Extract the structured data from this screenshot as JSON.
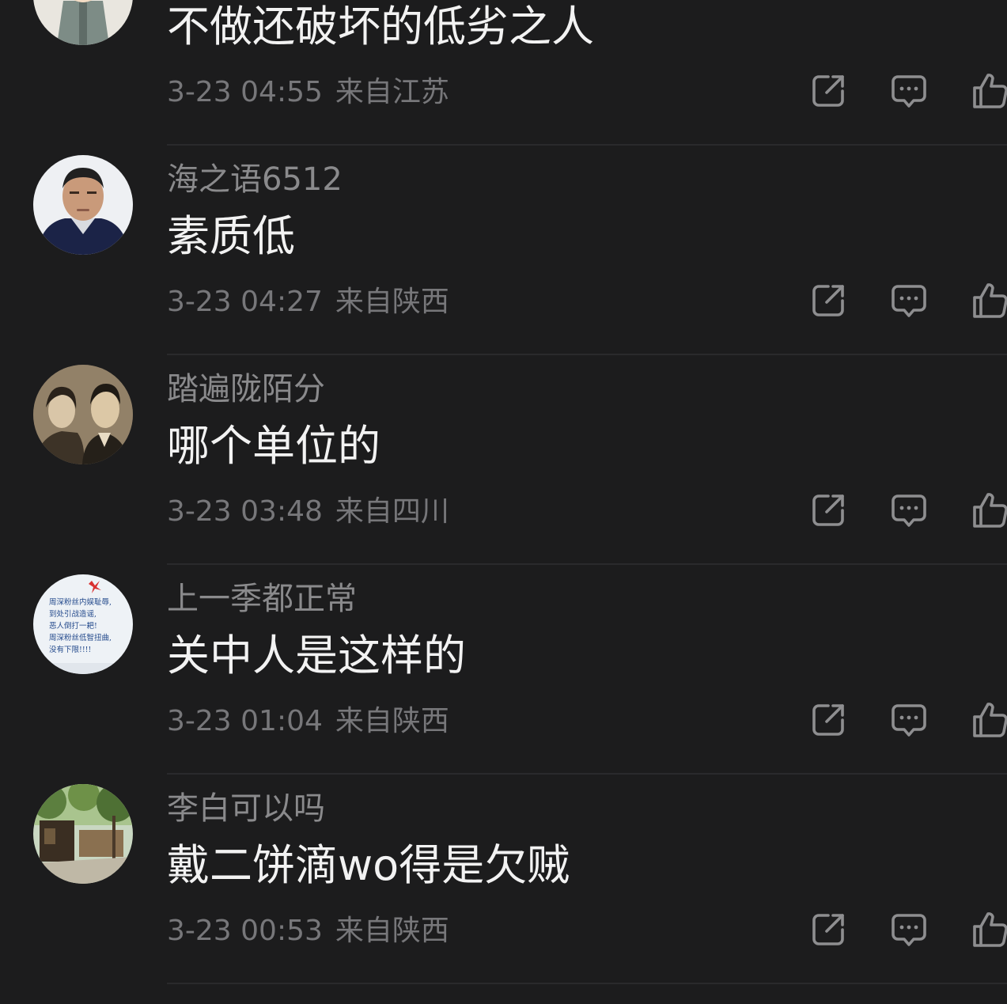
{
  "comments": [
    {
      "username": "",
      "avatar_icon": "cartoon-scholar-avatar",
      "content": "不做还破坏的低劣之人",
      "time": "3-23 04:55",
      "location": "来自江苏"
    },
    {
      "username": "海之语6512",
      "avatar_icon": "man-portrait-avatar",
      "content": "素质低",
      "time": "3-23 04:27",
      "location": "来自陕西"
    },
    {
      "username": "踏遍陇陌分",
      "avatar_icon": "vintage-couple-photo-avatar",
      "content": "哪个单位的",
      "time": "3-23 03:48",
      "location": "来自四川"
    },
    {
      "username": "上一季都正常",
      "avatar_icon": "text-note-avatar",
      "avatar_text": [
        "周深粉丝内娱耻辱,",
        "到处引战造谣,",
        "恶人倒打一耙!",
        "周深粉丝低智扭曲,",
        "没有下限!!!!"
      ],
      "content": "关中人是这样的",
      "time": "3-23 01:04",
      "location": "来自陕西"
    },
    {
      "username": "李白可以吗",
      "avatar_icon": "garden-scene-avatar",
      "content": "戴二饼滴wo得是欠贼",
      "time": "3-23 00:53",
      "location": "来自陕西"
    }
  ],
  "actions": {
    "share_icon": "share-icon",
    "reply_icon": "comment-bubble-icon",
    "like_icon": "thumbs-up-icon"
  },
  "colors": {
    "background": "#1c1c1d",
    "username": "#8a8a8c",
    "content": "#f2f2f2",
    "meta": "#77777a",
    "icon": "#8e8e90",
    "divider": "#2a2a2c"
  }
}
